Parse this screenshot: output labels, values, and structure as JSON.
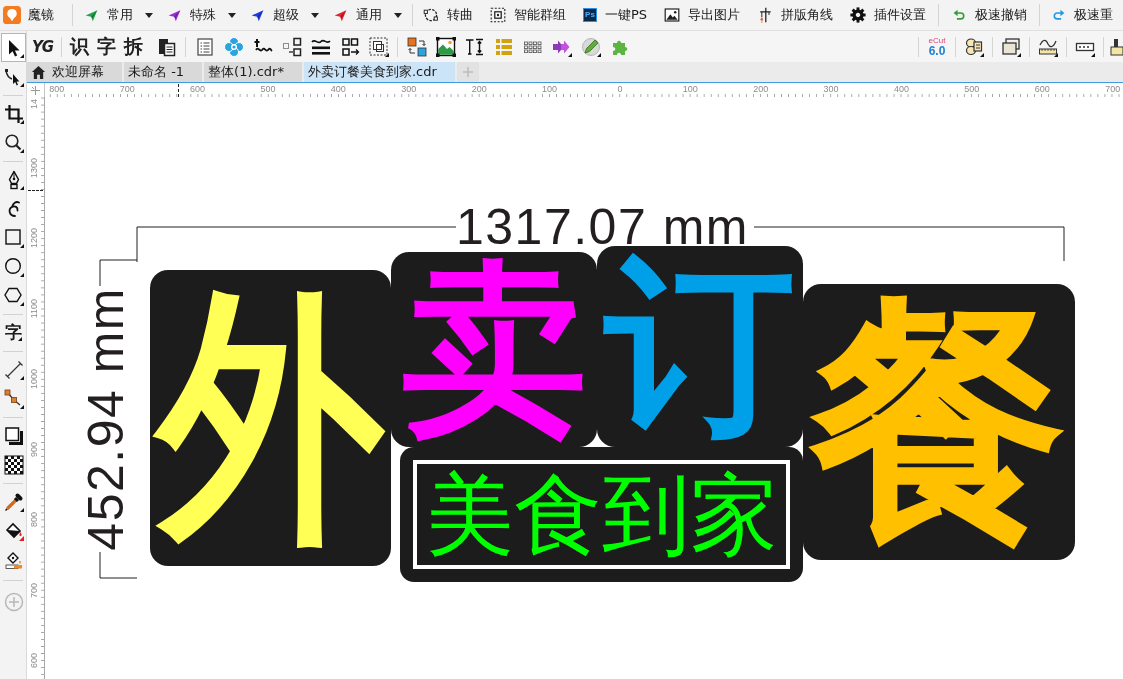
{
  "menubar": {
    "app_name": "魔镜",
    "dropdowns": [
      {
        "label": "常用",
        "color": "#1ea34a"
      },
      {
        "label": "特殊",
        "color": "#9a2bd6"
      },
      {
        "label": "超级",
        "color": "#1c3de0"
      },
      {
        "label": "通用",
        "color": "#e3232b"
      }
    ],
    "commands": [
      {
        "label": "转曲"
      },
      {
        "label": "智能群组"
      },
      {
        "label": "一键PS",
        "badge": "Ps"
      },
      {
        "label": "导出图片"
      },
      {
        "label": "拼版角线"
      },
      {
        "label": "插件设置"
      }
    ],
    "undo": "极速撤销",
    "redo": "极速重"
  },
  "toolbar": {
    "text_tools": [
      "YG",
      "识",
      "字",
      "拆"
    ],
    "ecut": {
      "name": "eCut",
      "version": "6.0"
    }
  },
  "toolbox": [
    {
      "selected": true
    },
    {
      "selected": false
    },
    {
      "selected": false
    },
    {
      "selected": false
    },
    {
      "selected": false
    },
    {
      "selected": false
    },
    {
      "selected": false
    },
    {
      "selected": false
    },
    {
      "selected": false
    },
    {
      "label": "字",
      "selected": false
    },
    {
      "selected": false
    },
    {
      "selected": false
    },
    {
      "selected": false
    },
    {
      "selected": false
    },
    {
      "selected": false
    },
    {
      "selected": false
    },
    {
      "selected": false
    },
    {
      "selected": false
    }
  ],
  "tabs": [
    {
      "label": "欢迎屏幕",
      "kind": "start",
      "selected": false
    },
    {
      "label": "未命名 -1",
      "kind": "document",
      "selected": false
    },
    {
      "label": "整体(1).cdr*",
      "kind": "document",
      "selected": false
    },
    {
      "label": "外卖订餐美食到家.cdr",
      "kind": "document",
      "selected": true
    }
  ],
  "rulers": {
    "horizontal": [
      "800",
      "700",
      "600",
      "500",
      "400",
      "300",
      "200",
      "100",
      "0",
      "100",
      "200",
      "300",
      "400",
      "500",
      "600",
      "700"
    ],
    "vertical": [
      "14",
      "1300",
      "1200",
      "1100",
      "1000",
      "900",
      "800",
      "700",
      "600"
    ]
  },
  "artwork": {
    "width_dimension": "1317.07 mm",
    "height_dimension": "452.94 mm",
    "headline": [
      {
        "text": "外",
        "color": "#ffff55"
      },
      {
        "text": "卖",
        "color": "#ff00ff"
      },
      {
        "text": "订",
        "color": "#00a0e9"
      },
      {
        "text": "餐",
        "color": "#ffc000"
      }
    ],
    "subtitle": "美食到家"
  }
}
